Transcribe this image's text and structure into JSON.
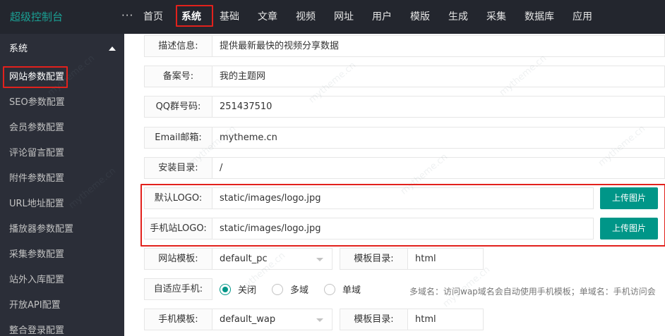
{
  "brand": "超级控制台",
  "more": "···",
  "nav": [
    "首页",
    "系统",
    "基础",
    "文章",
    "视频",
    "网址",
    "用户",
    "模版",
    "生成",
    "采集",
    "数据库",
    "应用"
  ],
  "sidebar": {
    "header": "系统",
    "items": [
      "网站参数配置",
      "SEO参数配置",
      "会员参数配置",
      "评论留言配置",
      "附件参数配置",
      "URL地址配置",
      "播放器参数配置",
      "采集参数配置",
      "站外入库配置",
      "开放API配置",
      "整合登录配置"
    ]
  },
  "form": {
    "desc": {
      "label": "描述信息:",
      "value": "提供最新最快的视频分享数据"
    },
    "icp": {
      "label": "备案号:",
      "value": "我的主题网"
    },
    "qq": {
      "label": "QQ群号码:",
      "value": "251437510"
    },
    "email": {
      "label": "Email邮箱:",
      "value": "mytheme.cn"
    },
    "install": {
      "label": "安装目录:",
      "value": "/"
    },
    "logo": {
      "label": "默认LOGO:",
      "value": "static/images/logo.jpg",
      "button": "上传图片"
    },
    "mlogo": {
      "label": "手机站LOGO:",
      "value": "static/images/logo.jpg",
      "button": "上传图片"
    },
    "template": {
      "label": "网站模板:",
      "value": "default_pc",
      "dir_label": "模板目录:",
      "dir_value": "html"
    },
    "adaptive": {
      "label": "自适应手机:",
      "options": [
        "关闭",
        "多域",
        "单域"
      ],
      "selected": 0,
      "hint": "多域名：访问wap域名会自动使用手机模板；单域名：手机访问会"
    },
    "mtemplate": {
      "label": "手机模板:",
      "value": "default_wap",
      "dir_label": "模板目录:",
      "dir_value": "html"
    }
  },
  "colors": {
    "accent": "#009688",
    "highlight": "#e2211c",
    "topbar": "#23262e",
    "sidebar": "#2b2e38"
  },
  "watermark": "mytheme.cn"
}
